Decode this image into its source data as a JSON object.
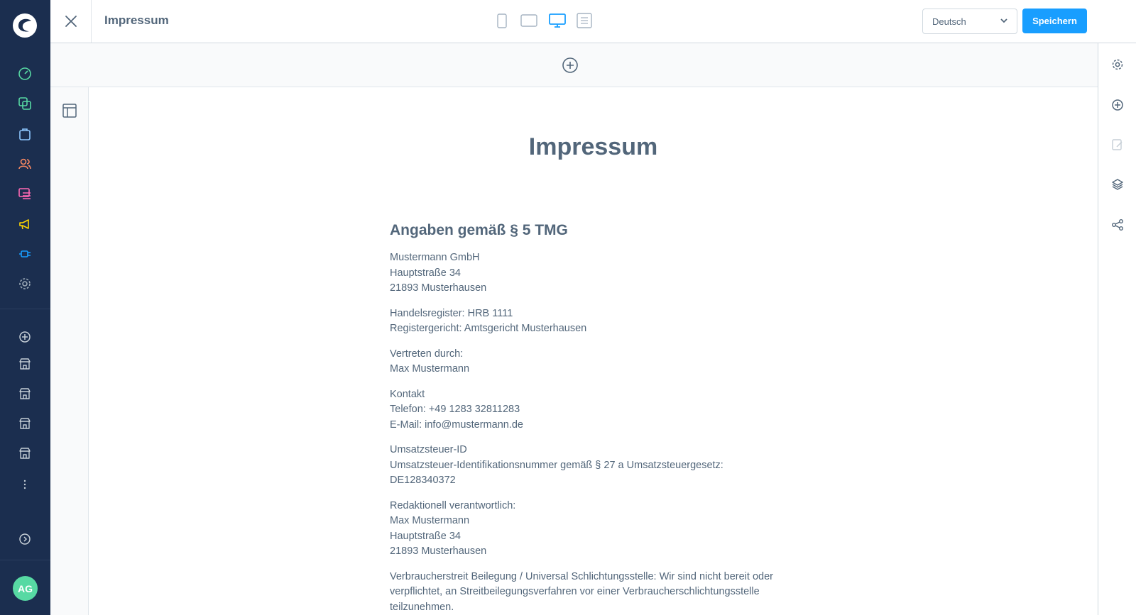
{
  "header": {
    "title": "Impressum",
    "language": "Deutsch",
    "save_label": "Speichern"
  },
  "user": {
    "initials": "AG"
  },
  "content": {
    "heading": "Impressum",
    "section_title": "Angaben gemäß § 5 TMG",
    "paragraphs": [
      [
        "Mustermann GmbH",
        "Hauptstraße 34",
        "21893 Musterhausen"
      ],
      [
        "Handelsregister: HRB 1111",
        "Registergericht: Amtsgericht Musterhausen"
      ],
      [
        "Vertreten durch:",
        "Max Mustermann"
      ],
      [
        "Kontakt",
        "Telefon: +49 1283 32811283",
        "E-Mail: info@mustermann.de"
      ],
      [
        "Umsatzsteuer-ID",
        "Umsatzsteuer-Identifikationsnummer gemäß § 27 a Umsatzsteuergesetz:",
        "DE128340372"
      ],
      [
        "Redaktionell verantwortlich:",
        "Max Mustermann",
        "Hauptstraße 34",
        "21893 Musterhausen"
      ],
      [
        "Verbraucherstreit Beilegung / Universal Schlichtungsstelle: Wir sind nicht bereit oder",
        "verpflichtet, an Streitbeilegungsverfahren vor einer Verbraucherschlichtungsstelle",
        "teilzunehmen."
      ]
    ]
  },
  "colors": {
    "sidebar_bg": "#1b2e4f",
    "primary": "#189eff",
    "text": "#52667a",
    "avatar": "#57d9a3"
  },
  "icons": {
    "sidebar": [
      "dashboard-icon",
      "catalogue-icon",
      "orders-icon",
      "customers-icon",
      "content-icon",
      "marketing-icon",
      "extensions-icon",
      "settings-icon",
      "add-sales-channel-icon",
      "storefront-icon",
      "storefront-icon",
      "storefront-icon",
      "storefront-icon",
      "more-icon",
      "expand-icon"
    ],
    "devices": [
      "mobile-icon",
      "tablet-icon",
      "desktop-icon",
      "form-icon"
    ],
    "right": [
      "settings-icon",
      "add-block-icon",
      "edit-icon",
      "layers-icon",
      "share-icon"
    ]
  }
}
